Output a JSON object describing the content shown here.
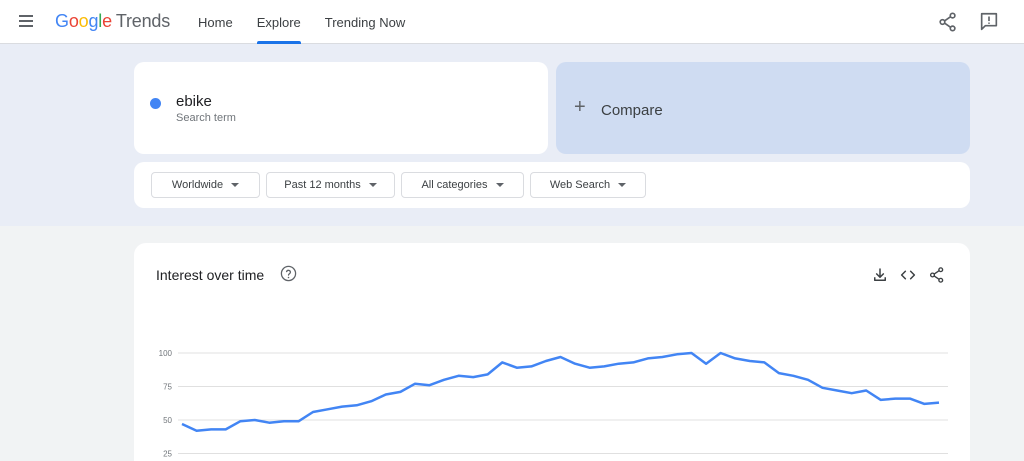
{
  "header": {
    "logo_parts": [
      "G",
      "o",
      "o",
      "g",
      "l",
      "e"
    ],
    "logo_suffix": "Trends",
    "nav": [
      {
        "label": "Home",
        "active": false
      },
      {
        "label": "Explore",
        "active": true
      },
      {
        "label": "Trending Now",
        "active": false
      }
    ],
    "icons": [
      "menu-icon",
      "share-icon",
      "feedback-icon"
    ]
  },
  "search": {
    "term": "ebike",
    "term_sublabel": "Search term",
    "term_color": "#4285f4",
    "compare_label": "Compare"
  },
  "filters": {
    "region": "Worldwide",
    "period": "Past 12 months",
    "category": "All categories",
    "property": "Web Search"
  },
  "interest": {
    "title": "Interest over time",
    "icons": [
      "help-icon",
      "download-icon",
      "embed-icon",
      "share-icon"
    ]
  },
  "chart_data": {
    "type": "line",
    "y_ticks": [
      "100",
      "75",
      "50",
      "25"
    ],
    "ylim": [
      0,
      100
    ],
    "grid": true,
    "series": [
      {
        "color": "#4285f4",
        "values": [
          47,
          42,
          43,
          43,
          49,
          50,
          48,
          49,
          49,
          56,
          58,
          60,
          61,
          64,
          69,
          71,
          77,
          76,
          80,
          83,
          82,
          84,
          93,
          89,
          90,
          94,
          97,
          92,
          89,
          90,
          92,
          93,
          96,
          97,
          99,
          100,
          92,
          100,
          96,
          94,
          93,
          85,
          83,
          80,
          74,
          72,
          70,
          72,
          65,
          66,
          66,
          62,
          63
        ]
      }
    ]
  }
}
